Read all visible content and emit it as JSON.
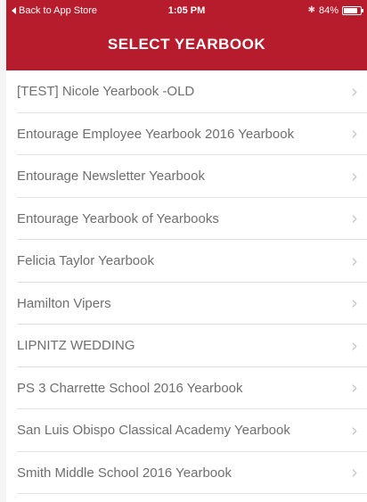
{
  "colors": {
    "header_bg": "#b71c2c",
    "header_text": "#ffffff",
    "item_text": "#6f6f6f",
    "chevron": "#c8c8c8",
    "divider": "#e2e2e2"
  },
  "status_bar": {
    "back_label": "Back to App Store",
    "time": "1:05 PM",
    "battery_text": "84%",
    "battery_level": 0.84,
    "bluetooth_icon": "bluetooth-icon"
  },
  "header": {
    "title": "SELECT YEARBOOK"
  },
  "yearbooks": [
    {
      "label": "[TEST] Nicole Yearbook -OLD"
    },
    {
      "label": "Entourage Employee Yearbook 2016 Yearbook"
    },
    {
      "label": "Entourage Newsletter Yearbook"
    },
    {
      "label": "Entourage Yearbook of Yearbooks"
    },
    {
      "label": "Felicia Taylor Yearbook"
    },
    {
      "label": "Hamilton Vipers"
    },
    {
      "label": "LIPNITZ WEDDING"
    },
    {
      "label": "PS 3 Charrette School 2016 Yearbook"
    },
    {
      "label": "San Luis Obispo Classical Academy Yearbook"
    },
    {
      "label": "Smith Middle School 2016 Yearbook"
    }
  ],
  "chevron_icon": "chevron-right-icon"
}
